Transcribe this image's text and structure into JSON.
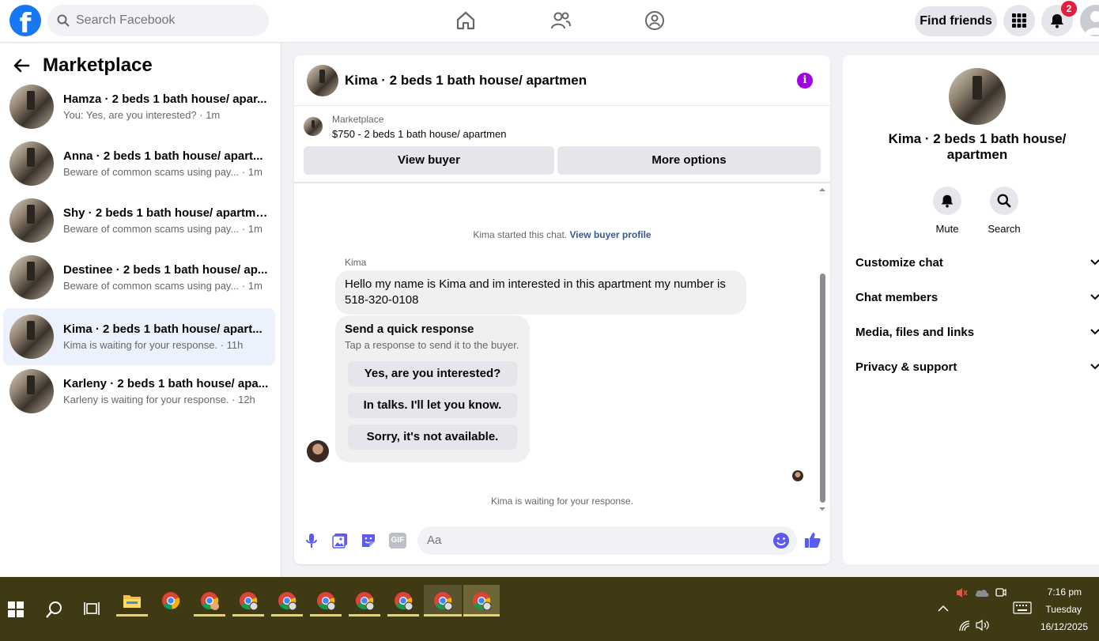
{
  "topbar": {
    "logo": "f",
    "search_placeholder": "Search Facebook",
    "find_friends": "Find friends",
    "notification_count": "2"
  },
  "left": {
    "title": "Marketplace",
    "conversations": [
      {
        "name": "Hamza · 2 beds 1 bath house/ apar...",
        "sub": "You: Yes, are you interested? · 1m"
      },
      {
        "name": "Anna · 2 beds 1 bath house/ apart...",
        "sub": "Beware of common scams using pay... · 1m"
      },
      {
        "name": "Shy · 2 beds 1 bath house/ apartmen",
        "sub": "Beware of common scams using pay... · 1m"
      },
      {
        "name": "Destinee · 2 beds 1 bath house/ ap...",
        "sub": "Beware of common scams using pay... · 1m"
      },
      {
        "name": "Kima · 2 beds 1 bath house/ apart...",
        "sub": "Kima is waiting for your response. · 11h"
      },
      {
        "name": "Karleny · 2 beds 1 bath house/ apa...",
        "sub": "Karleny is waiting for your response. · 12h"
      }
    ]
  },
  "chat": {
    "title": "Kima · 2 beds 1 bath house/ apartmen",
    "info": "i",
    "marketplace_label": "Marketplace",
    "listing": "$750 - 2 beds 1 bath house/ apartmen",
    "view_buyer": "View buyer",
    "more_options": "More options",
    "started_text": "Kima started this chat.",
    "view_profile": "View buyer profile",
    "sender": "Kima",
    "message": "Hello my name is Kima and im interested in this apartment my number is 518-320-0108",
    "quick_title": "Send a quick response",
    "quick_sub": "Tap a response to send it to the buyer.",
    "quick_options": [
      "Yes, are you interested?",
      "In talks. I'll let you know.",
      "Sorry, it's not available."
    ],
    "waiting": "Kima is waiting for your response.",
    "composer_placeholder": "Aa",
    "gif": "GIF"
  },
  "right": {
    "name": "Kima · 2 beds 1 bath house/ apartmen",
    "mute": "Mute",
    "search": "Search",
    "sections": [
      "Customize chat",
      "Chat members",
      "Media, files and links",
      "Privacy & support"
    ]
  },
  "taskbar": {
    "time": "7:16 pm",
    "day": "Tuesday",
    "date": "16/12/2025"
  },
  "colors": {
    "accent": "#1877f2",
    "messenger_purple": "#a000e6",
    "icon_blue": "#5b5bf2"
  }
}
